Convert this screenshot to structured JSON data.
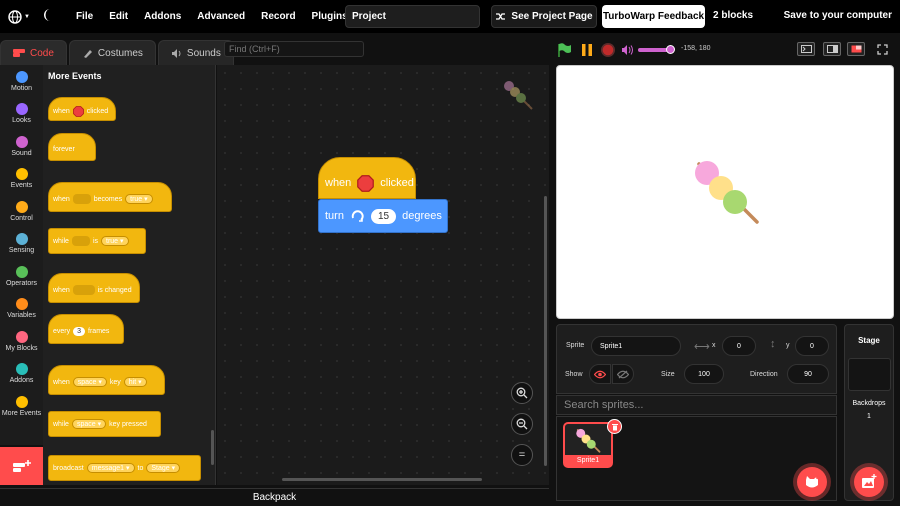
{
  "menubar": {
    "items": [
      "File",
      "Edit",
      "Addons",
      "Advanced",
      "Record",
      "Plugins"
    ],
    "project_title": "Project",
    "see_project": "See Project Page",
    "feedback": "TurboWarp Feedback",
    "block_count": "2 blocks",
    "save": "Save to your computer"
  },
  "tabs": [
    "Code",
    "Costumes",
    "Sounds"
  ],
  "find_placeholder": "Find (Ctrl+F)",
  "categories": [
    {
      "label": "Motion",
      "color": "#4c97ff"
    },
    {
      "label": "Looks",
      "color": "#9966ff"
    },
    {
      "label": "Sound",
      "color": "#cf63cf"
    },
    {
      "label": "Events",
      "color": "#ffbf00"
    },
    {
      "label": "Control",
      "color": "#ffab19"
    },
    {
      "label": "Sensing",
      "color": "#5cb1d6"
    },
    {
      "label": "Operators",
      "color": "#59c059"
    },
    {
      "label": "Variables",
      "color": "#ff8c1a"
    },
    {
      "label": "My Blocks",
      "color": "#ff6680"
    },
    {
      "label": "Addons",
      "color": "#29beb8"
    },
    {
      "label": "More Events",
      "color": "#ffbf00"
    }
  ],
  "palette": {
    "title": "More Events",
    "b1_when": "when",
    "b1_clicked": "clicked",
    "b2": "forever",
    "b3_when": "when",
    "b3_becomes": "becomes",
    "b3_val": "true",
    "b4_while": "while",
    "b4_is": "is",
    "b4_val": "true",
    "b5_when": "when",
    "b5_changed": "is changed",
    "b6_every": "every",
    "b6_num": "3",
    "b6_frames": "frames",
    "b7_when": "when",
    "b7_key": "space",
    "b7_keylabel": "key",
    "b7_hit": "hit",
    "b8_while": "while",
    "b8_key": "space",
    "b8_pressed": "key pressed",
    "b9_broadcast": "broadcast",
    "b9_msg": "message1",
    "b9_to": "to",
    "b9_target": "Stage"
  },
  "script": {
    "hat_when": "when",
    "hat_clicked": "clicked",
    "turn": "turn",
    "degrees_value": "15",
    "degrees": "degrees"
  },
  "zoom": {
    "reset": "="
  },
  "backpack": "Backpack",
  "coords": "-158, 180",
  "sprite": {
    "label": "Sprite",
    "name": "Sprite1",
    "x_label": "x",
    "x": "0",
    "y_label": "y",
    "y": "0",
    "show_label": "Show",
    "size_label": "Size",
    "size": "100",
    "direction_label": "Direction",
    "direction": "90",
    "search_placeholder": "Search sprites...",
    "thumb_label": "Sprite1"
  },
  "stage_panel": {
    "title": "Stage",
    "backdrops_label": "Backdrops",
    "backdrops_count": "1"
  },
  "colors": {
    "accent": "#ff4c4c",
    "events": "#f2b70f",
    "motion": "#4c97ff"
  }
}
